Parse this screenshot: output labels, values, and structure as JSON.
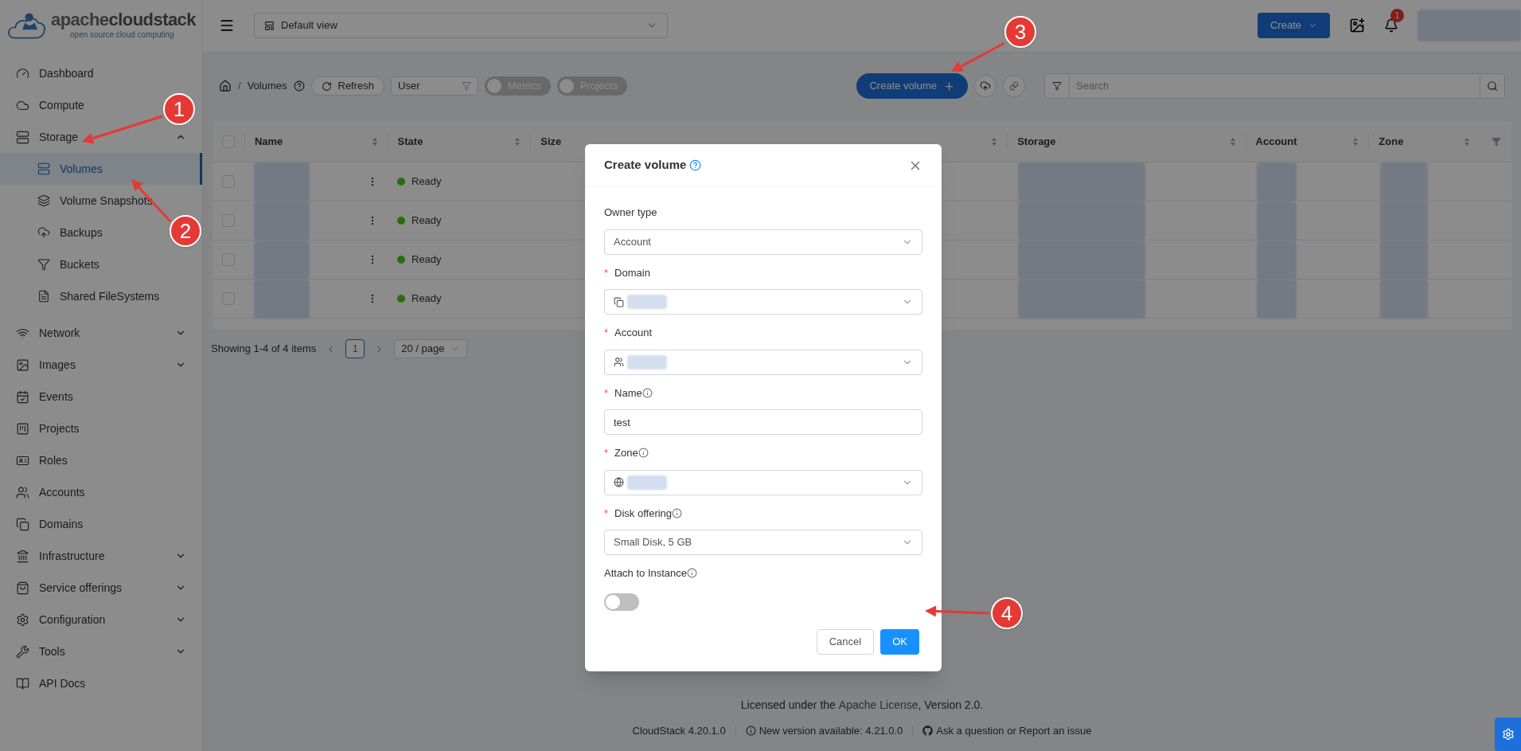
{
  "logo": {
    "name_light": "apache",
    "name_bold": "cloudstack",
    "tagline": "open source cloud computing"
  },
  "sidebar": {
    "items": [
      {
        "label": "Dashboard"
      },
      {
        "label": "Compute"
      },
      {
        "label": "Storage",
        "expanded": true,
        "children": [
          {
            "label": "Volumes",
            "selected": true
          },
          {
            "label": "Volume Snapshots",
            "selected": false
          },
          {
            "label": "Backups",
            "selected": false
          },
          {
            "label": "Buckets",
            "selected": false
          },
          {
            "label": "Shared FileSystems",
            "selected": false
          }
        ]
      },
      {
        "label": "Network",
        "expanded": false
      },
      {
        "label": "Images",
        "expanded": false
      },
      {
        "label": "Events"
      },
      {
        "label": "Projects"
      },
      {
        "label": "Roles"
      },
      {
        "label": "Accounts"
      },
      {
        "label": "Domains"
      },
      {
        "label": "Infrastructure",
        "expanded": false
      },
      {
        "label": "Service offerings",
        "expanded": false
      },
      {
        "label": "Configuration",
        "expanded": false
      },
      {
        "label": "Tools",
        "expanded": false
      },
      {
        "label": "API Docs"
      }
    ]
  },
  "header": {
    "view_select": "Default view",
    "create_button": "Create",
    "notification_count": "1"
  },
  "toolbar": {
    "breadcrumb_separator": "/",
    "breadcrumb": "Volumes",
    "refresh": "Refresh",
    "filter_select": "User",
    "toggles": [
      {
        "label": "Metrics",
        "on": false
      },
      {
        "label": "Projects",
        "on": false
      }
    ],
    "create_volume": "Create volume",
    "search_placeholder": "Search"
  },
  "table": {
    "header_checked": false,
    "columns": [
      "Name",
      "State",
      "Size",
      "Storage",
      "Account",
      "Zone"
    ],
    "rows": [
      {
        "state": "Ready",
        "selected": false
      },
      {
        "state": "Ready",
        "selected": false
      },
      {
        "state": "Ready",
        "selected": false
      },
      {
        "state": "Ready",
        "selected": false
      }
    ]
  },
  "pagination": {
    "summary": "Showing 1-4 of 4 items",
    "pages": [
      {
        "label": "1",
        "selected": true
      }
    ],
    "page_size": "20 / page"
  },
  "modal": {
    "title": "Create volume",
    "fields": [
      {
        "label": "Owner type",
        "kind": "select",
        "info": false,
        "value": "Account"
      },
      {
        "required_mark": "*",
        "label": "Domain",
        "kind": "select",
        "info": false,
        "redacted": true
      },
      {
        "required_mark": "*",
        "label": "Account",
        "kind": "select",
        "info": false,
        "redacted": true
      },
      {
        "required_mark": "*",
        "label": "Name",
        "kind": "input",
        "info": true,
        "value": "test"
      },
      {
        "required_mark": "*",
        "label": "Zone",
        "kind": "select",
        "info": true,
        "redacted": true
      },
      {
        "required_mark": "*",
        "label": "Disk offering",
        "kind": "select",
        "info": true,
        "value": "Small Disk, 5 GB"
      },
      {
        "label": "Attach to Instance",
        "kind": "switch",
        "info": true,
        "on": false
      }
    ],
    "buttons": [
      {
        "label": "Cancel",
        "kind": "default"
      },
      {
        "label": "OK",
        "kind": "primary"
      }
    ]
  },
  "footer": {
    "license_prefix": "Licensed under the",
    "license_link": "Apache License",
    "license_suffix": ", Version 2.0.",
    "version": "CloudStack 4.20.1.0",
    "update": "New version available: 4.21.0.0",
    "support": "Ask a question or Report an issue"
  },
  "callouts": [
    {
      "number": "1"
    },
    {
      "number": "2"
    },
    {
      "number": "3"
    },
    {
      "number": "4"
    }
  ]
}
